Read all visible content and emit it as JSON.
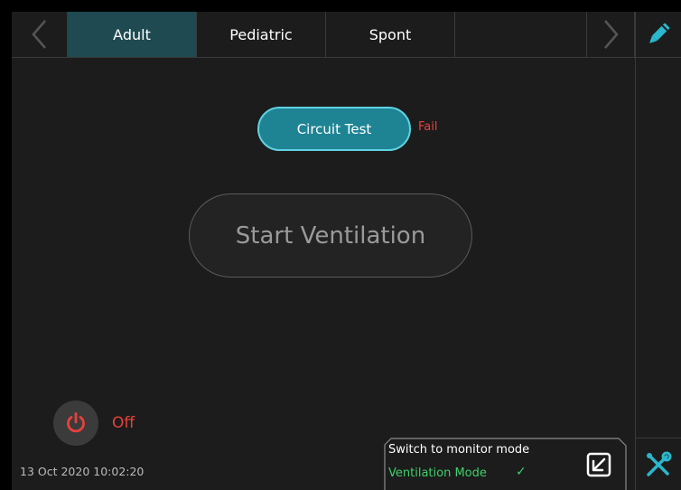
{
  "tabs": {
    "items": [
      {
        "label": "Adult",
        "active": true
      },
      {
        "label": "Pediatric",
        "active": false
      },
      {
        "label": "Spont",
        "active": false
      }
    ]
  },
  "icons": {
    "prev": "chevron-left-icon",
    "next": "chevron-right-icon",
    "edit": "pencil-icon",
    "tools": "wrench-screwdriver-icon",
    "power": "power-icon",
    "monitor": "arrow-down-left-box-icon",
    "check": "check-icon"
  },
  "circuit_test": {
    "label": "Circuit Test",
    "status": "Fail"
  },
  "start_ventilation": {
    "label": "Start Ventilation"
  },
  "power": {
    "label": "Off"
  },
  "datetime": "13 Oct 2020 10:02:20",
  "monitor": {
    "title": "Switch to monitor mode",
    "mode": "Ventilation Mode",
    "check": "✓"
  },
  "colors": {
    "accent_teal": "#1e8494",
    "accent_teal_border": "#5fd2e2",
    "active_tab": "#1f4a52",
    "alert_red": "#e8413a",
    "ok_green": "#3ecf6a",
    "background": "#1c1c1c"
  }
}
